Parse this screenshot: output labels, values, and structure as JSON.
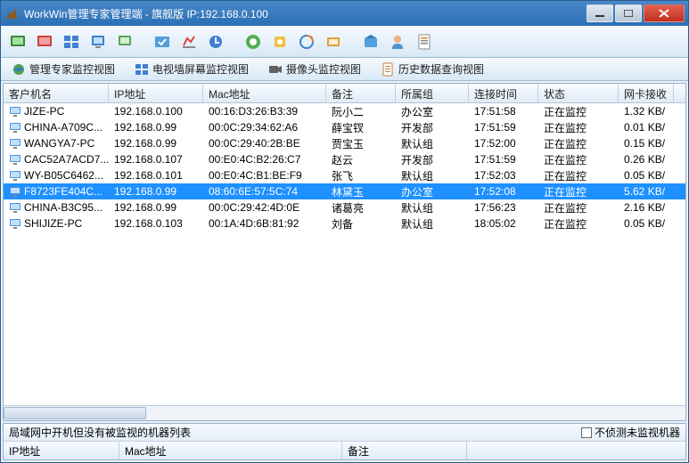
{
  "title": "WorkWin管理专家管理端 - 旗舰版 IP:192.168.0.100",
  "tabs": [
    {
      "icon": "globe",
      "label": "管理专家监控视图"
    },
    {
      "icon": "wall",
      "label": "电视墙屏幕监控视图"
    },
    {
      "icon": "camera",
      "label": "摄像头监控视图"
    },
    {
      "icon": "history",
      "label": "历史数据查询视图"
    }
  ],
  "columns": {
    "name": "客户机名",
    "ip": "IP地址",
    "mac": "Mac地址",
    "note": "备注",
    "group": "所属组",
    "conn": "连接时间",
    "stat": "状态",
    "net": "网卡接收"
  },
  "rows": [
    {
      "name": "JIZE-PC",
      "ip": "192.168.0.100",
      "mac": "00:16:D3:26:B3:39",
      "note": "阮小二",
      "group": "办公室",
      "conn": "17:51:58",
      "stat": "正在监控",
      "net": "1.32 KB/"
    },
    {
      "name": "CHINA-A709C...",
      "ip": "192.168.0.99",
      "mac": "00:0C:29:34:62:A6",
      "note": "薛宝钗",
      "group": "开发部",
      "conn": "17:51:59",
      "stat": "正在监控",
      "net": "0.01 KB/"
    },
    {
      "name": "WANGYA7-PC",
      "ip": "192.168.0.99",
      "mac": "00:0C:29:40:2B:BE",
      "note": "贾宝玉",
      "group": "默认组",
      "conn": "17:52:00",
      "stat": "正在监控",
      "net": "0.15 KB/"
    },
    {
      "name": "CAC52A7ACD7...",
      "ip": "192.168.0.107",
      "mac": "00:E0:4C:B2:26:C7",
      "note": "赵云",
      "group": "开发部",
      "conn": "17:51:59",
      "stat": "正在监控",
      "net": "0.26 KB/"
    },
    {
      "name": "WY-B05C6462...",
      "ip": "192.168.0.101",
      "mac": "00:E0:4C:B1:BE:F9",
      "note": "张飞",
      "group": "默认组",
      "conn": "17:52:03",
      "stat": "正在监控",
      "net": "0.05 KB/"
    },
    {
      "name": "F8723FE404C...",
      "ip": "192.168.0.99",
      "mac": "08:60:6E:57:5C:74",
      "note": "林黛玉",
      "group": "办公室",
      "conn": "17:52:08",
      "stat": "正在监控",
      "net": "5.62 KB/",
      "sel": true
    },
    {
      "name": "CHINA-B3C95...",
      "ip": "192.168.0.99",
      "mac": "00:0C:29:42:4D:0E",
      "note": "诸葛亮",
      "group": "默认组",
      "conn": "17:56:23",
      "stat": "正在监控",
      "net": "2.16 KB/"
    },
    {
      "name": "SHIJIZE-PC",
      "ip": "192.168.0.103",
      "mac": "00:1A:4D:6B:81:92",
      "note": "刘备",
      "group": "默认组",
      "conn": "18:05:02",
      "stat": "正在监控",
      "net": "0.05 KB/"
    }
  ],
  "bottom": {
    "title": "局域网中开机但没有被监视的机器列表",
    "checkbox": "不侦测未监视机器",
    "cols": {
      "ip": "IP地址",
      "mac": "Mac地址",
      "note": "备注"
    }
  }
}
